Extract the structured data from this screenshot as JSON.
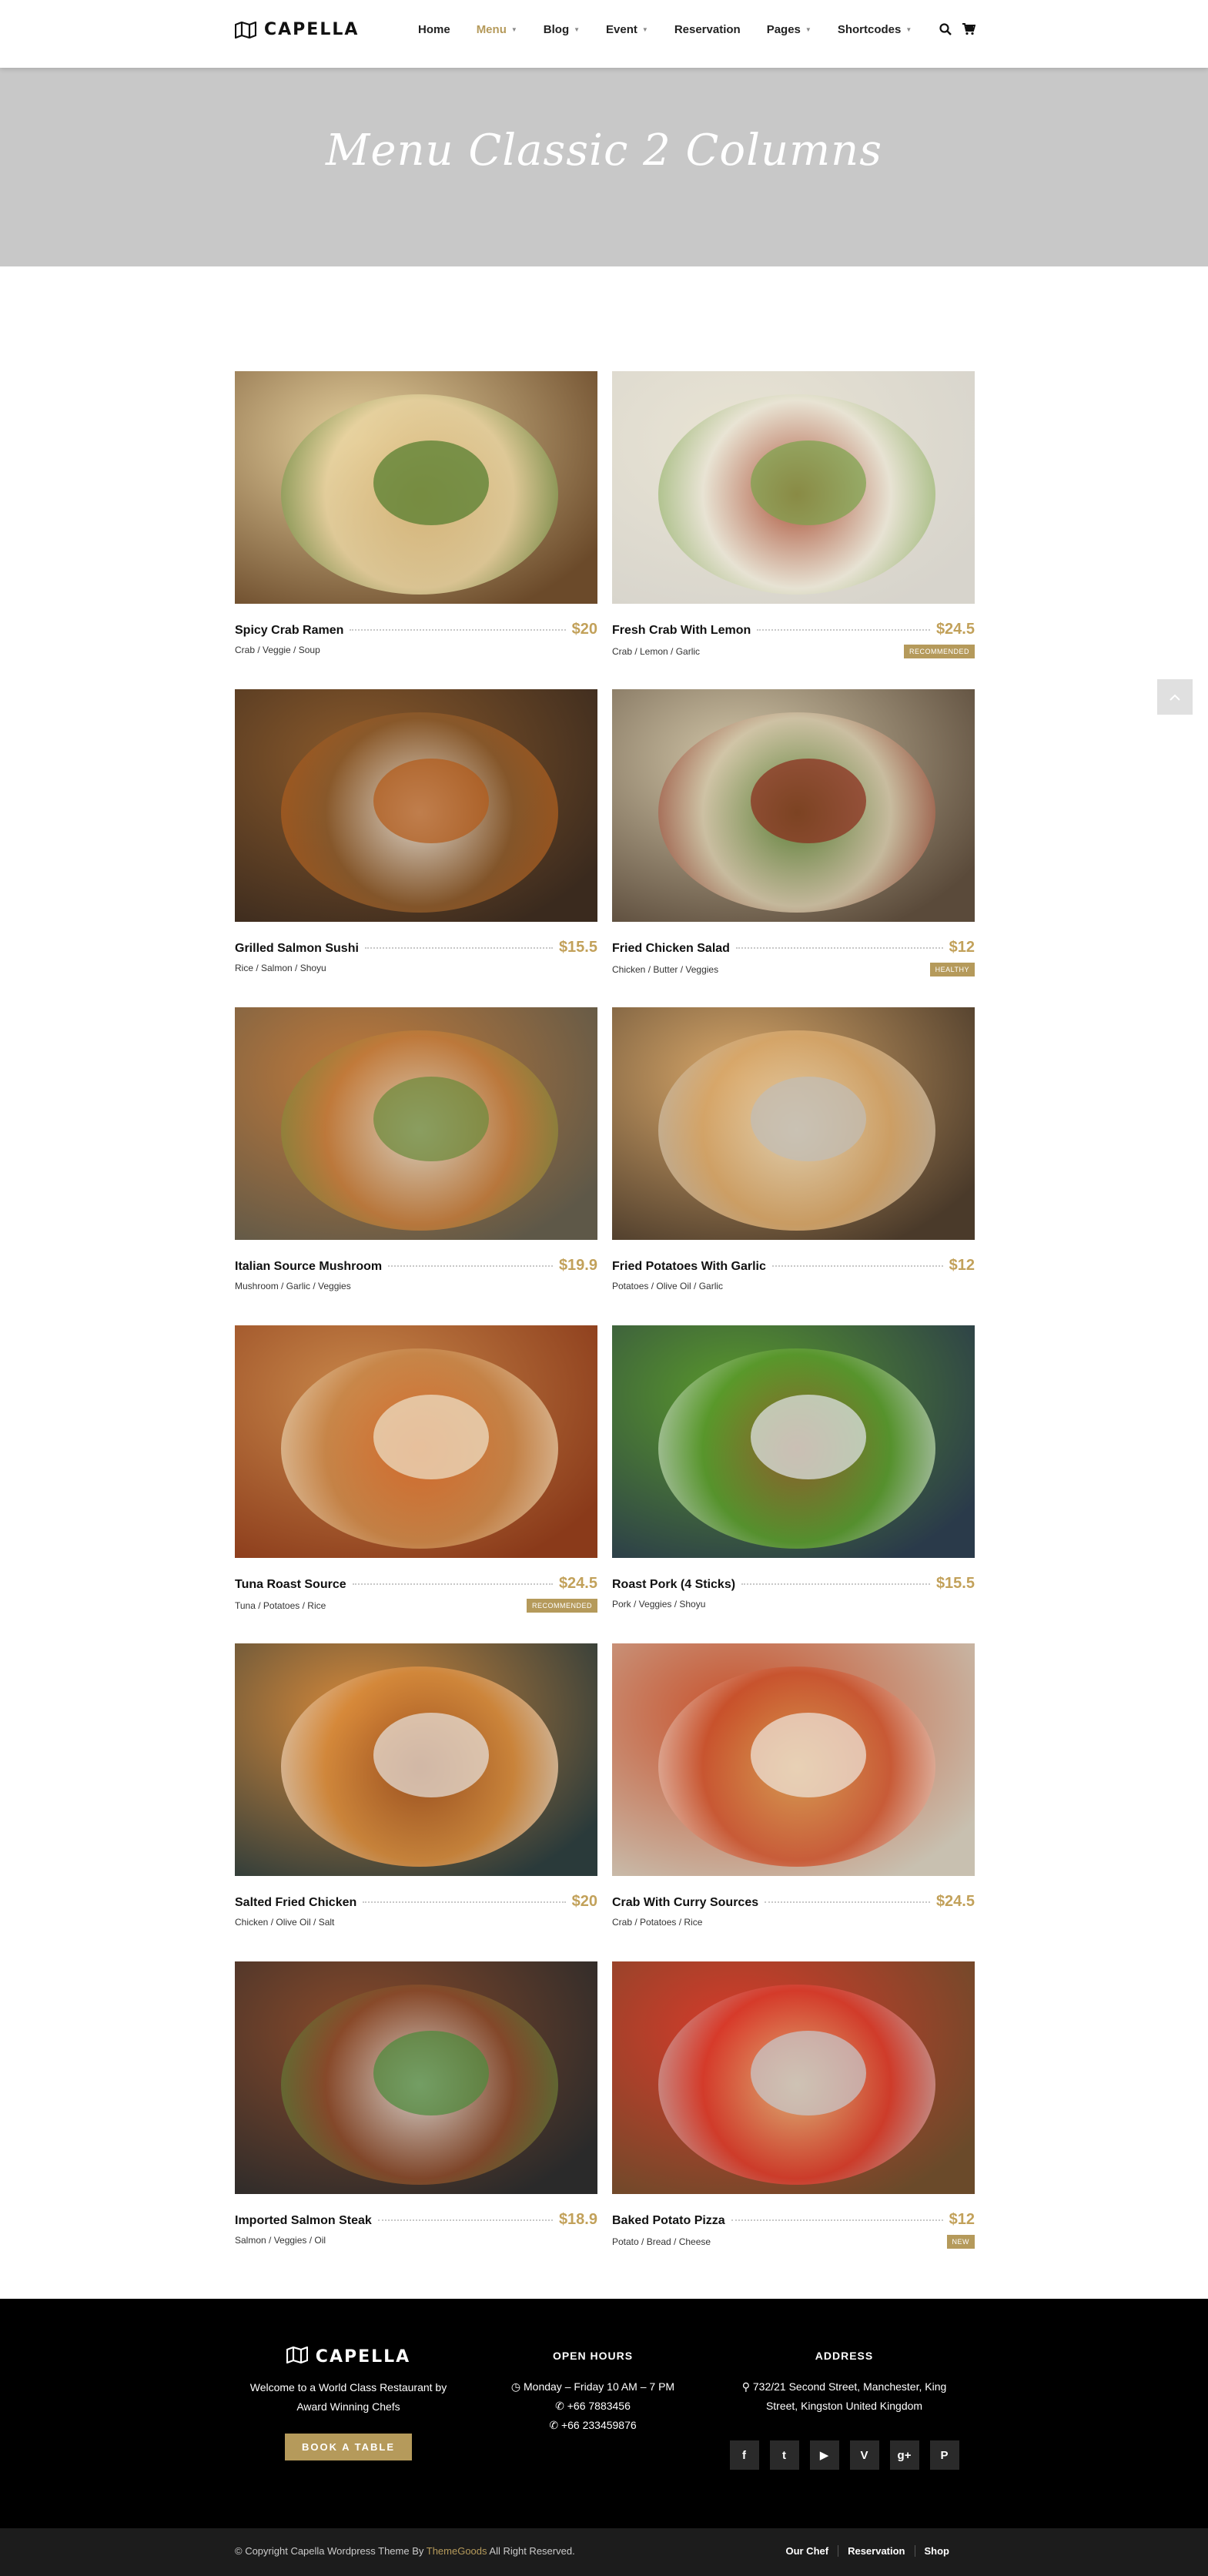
{
  "header": {
    "logo_text": "CAPELLA",
    "nav": [
      {
        "label": "Home",
        "dropdown": false,
        "active": false
      },
      {
        "label": "Menu",
        "dropdown": true,
        "active": true
      },
      {
        "label": "Blog",
        "dropdown": true,
        "active": false
      },
      {
        "label": "Event",
        "dropdown": true,
        "active": false
      },
      {
        "label": "Reservation",
        "dropdown": false,
        "active": false
      },
      {
        "label": "Pages",
        "dropdown": true,
        "active": false
      },
      {
        "label": "Shortcodes",
        "dropdown": true,
        "active": false
      }
    ],
    "icons": [
      "search-icon",
      "cart-icon"
    ]
  },
  "banner": {
    "title": "Menu Classic 2 Columns"
  },
  "colors": {
    "accent": "#b59a5b",
    "price": "#c2a15a",
    "banner": "#c8c8c8",
    "footer": "#000000"
  },
  "menu": {
    "items": [
      {
        "name": "Spicy Crab Ramen",
        "price": "$20",
        "ingredients": "Crab / Veggie / Soup",
        "badge": ""
      },
      {
        "name": "Fresh Crab With Lemon",
        "price": "$24.5",
        "ingredients": "Crab / Lemon / Garlic",
        "badge": "RECOMMENDED"
      },
      {
        "name": "Grilled Salmon Sushi",
        "price": "$15.5",
        "ingredients": "Rice / Salmon / Shoyu",
        "badge": ""
      },
      {
        "name": "Fried Chicken Salad",
        "price": "$12",
        "ingredients": "Chicken / Butter / Veggies",
        "badge": "HEALTHY"
      },
      {
        "name": "Italian Source Mushroom",
        "price": "$19.9",
        "ingredients": "Mushroom / Garlic / Veggies",
        "badge": ""
      },
      {
        "name": "Fried Potatoes With Garlic",
        "price": "$12",
        "ingredients": "Potatoes / Olive Oil / Garlic",
        "badge": ""
      },
      {
        "name": "Tuna Roast Source",
        "price": "$24.5",
        "ingredients": "Tuna / Potatoes / Rice",
        "badge": "RECOMMENDED"
      },
      {
        "name": "Roast Pork (4 Sticks)",
        "price": "$15.5",
        "ingredients": "Pork / Veggies / Shoyu",
        "badge": ""
      },
      {
        "name": "Salted Fried Chicken",
        "price": "$20",
        "ingredients": "Chicken / Olive Oil / Salt",
        "badge": ""
      },
      {
        "name": "Crab With Curry Sources",
        "price": "$24.5",
        "ingredients": "Crab / Potatoes / Rice",
        "badge": ""
      },
      {
        "name": "Imported Salmon Steak",
        "price": "$18.9",
        "ingredients": "Salmon / Veggies / Oil",
        "badge": ""
      },
      {
        "name": "Baked Potato Pizza",
        "price": "$12",
        "ingredients": "Potato / Bread / Cheese",
        "badge": "NEW"
      }
    ]
  },
  "scroll_top": {
    "icon": "chevron-up-icon"
  },
  "footer": {
    "logo_text": "CAPELLA",
    "tagline": "Welcome to a World Class Restaurant by Award Winning Chefs",
    "book_label": "BOOK A TABLE",
    "hours_heading": "OPEN HOURS",
    "hours": "Monday – Friday 10 AM – 7 PM",
    "phone1": "+66 7883456",
    "phone2": "+66 233459876",
    "address_heading": "ADDRESS",
    "address": "732/21 Second Street, Manchester, King Street, Kingston United Kingdom",
    "social": [
      {
        "name": "facebook-icon",
        "glyph": "f"
      },
      {
        "name": "twitter-icon",
        "glyph": "t"
      },
      {
        "name": "youtube-icon",
        "glyph": "▶"
      },
      {
        "name": "vimeo-icon",
        "glyph": "V"
      },
      {
        "name": "google-plus-icon",
        "glyph": "g+"
      },
      {
        "name": "pinterest-icon",
        "glyph": "P"
      }
    ],
    "copyright_before": "© Copyright Capella Wordpress Theme By ",
    "copyright_brand": "ThemeGoods",
    "copyright_after": " All Right Reserved.",
    "links": [
      "Our Chef",
      "Reservation",
      "Shop"
    ]
  }
}
